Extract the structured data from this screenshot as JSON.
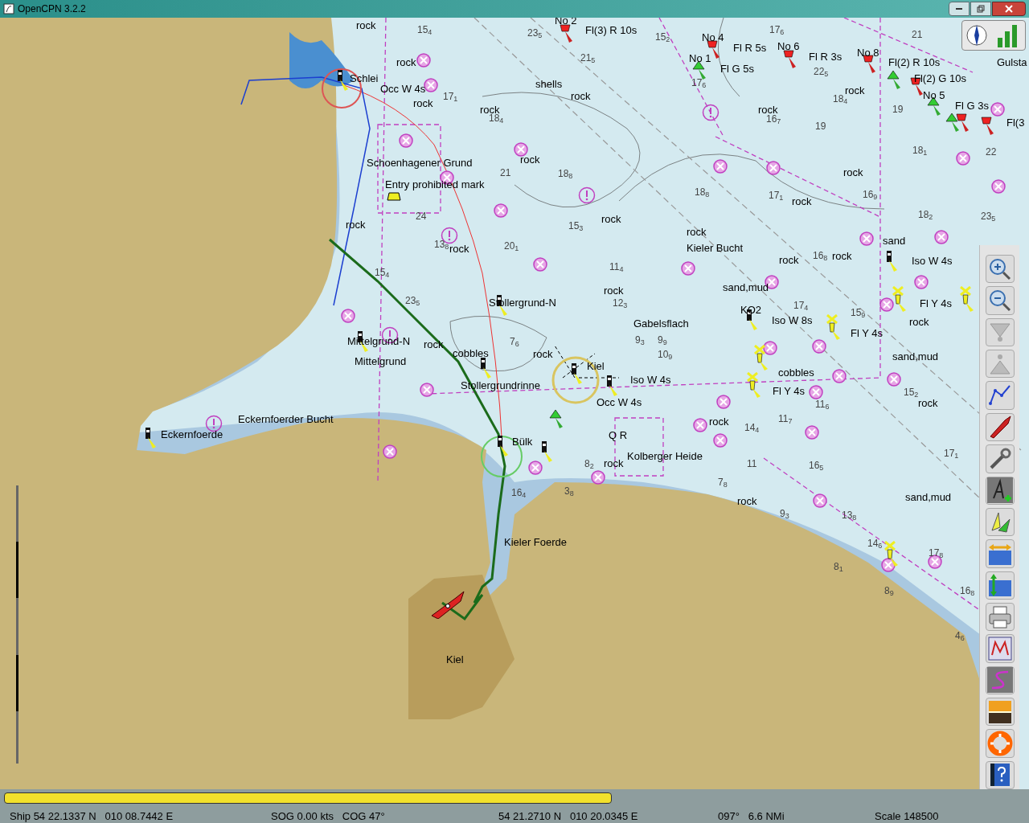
{
  "window": {
    "title": "OpenCPN 3.2.2"
  },
  "labels": [
    "rock",
    "No 2",
    "Fl(3) R 10s",
    "No 4",
    "Fl R 5s",
    "No 6",
    "rock",
    "No 1",
    "Fl R 3s",
    "No 8",
    "Fl(2) R 10s",
    "Gulsta",
    "Schlei",
    "Fl G 5s",
    "Fl(2) G 10s",
    "Occ W 4s",
    "shells",
    "rock",
    "rock",
    "No 5",
    "rock",
    "rock",
    "rock",
    "Fl G 3s",
    "Fl(3",
    "Schoenhagener Grund",
    "rock",
    "rock",
    "Entry prohibited mark",
    "rock",
    "rock",
    "rock",
    "rock",
    "sand",
    "rock",
    "Kieler Bucht",
    "rock",
    "rock",
    "Iso W 4s",
    "rock",
    "sand,mud",
    "Stollergrund-N",
    "Fl Y 4s",
    "KO2",
    "Gabelsflach",
    "Iso W 8s",
    "rock",
    "Fl Y 4s",
    "Mittelgrund-N",
    "rock",
    "cobbles",
    "rock",
    "sand,mud",
    "Mittelgrund",
    "Kiel",
    "cobbles",
    "Iso W 4s",
    "Stollergrundrinne",
    "Fl Y 4s",
    "Occ W 4s",
    "rock",
    "Eckernfoerder Bucht",
    "rock",
    "Eckernfoerde",
    "Q R",
    "Bülk",
    "Kolberger Heide",
    "rock",
    "rock",
    "sand,mud",
    "Kieler Foerde",
    "Kiel"
  ],
  "soundings": [
    "15$_{4}$",
    "23$_{5}$",
    "15$_{2}$",
    "17$_{6}$",
    "21",
    "21$_{5}$",
    "22$_{5}$",
    "17$_{6}$",
    "17$_{1}$",
    "18$_{4}$",
    "19",
    "18$_{4}$",
    "16$_{7}$",
    "19",
    "18$_{1}$",
    "22",
    "21",
    "18$_{8}$",
    "18$_{8}$",
    "17$_{1}$",
    "16$_{9}$",
    "24",
    "18$_{2}$",
    "23$_{5}$",
    "15$_{3}$",
    "13$_{8}$",
    "20$_{1}$",
    "16$_{8}$",
    "11$_{4}$",
    "15$_{4}$",
    "23$_{5}$",
    "12$_{3}$",
    "17$_{4}$",
    "15$_{9}$",
    "7$_{6}$",
    "9$_{3}$",
    "9$_{9}$",
    "10$_{9}$",
    "15$_{2}$",
    "11$_{6}$",
    "11$_{7}$",
    "14$_{4}$",
    "17$_{1}$",
    "8$_{2}$",
    "11",
    "16$_{5}$",
    "7$_{8}$",
    "16$_{4}$",
    "3$_{8}$",
    "9$_{3}$",
    "13$_{8}$",
    "14$_{6}$",
    "17$_{8}$",
    "8$_{1}$",
    "8$_{9}$",
    "16$_{8}$",
    "4$_{6}$"
  ],
  "progress": {
    "level": 0.595
  },
  "status_bar": [
    "Ship 54 22.1337 N   010 08.7442 E",
    "SOG 0.00 kts   COG 47°",
    "54 21.2710 N   010 20.0345 E",
    "097°   6.6 NMi",
    "Scale 148500"
  ]
}
